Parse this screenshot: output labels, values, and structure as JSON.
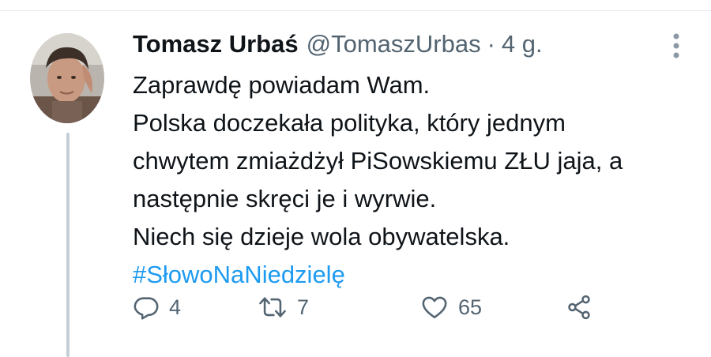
{
  "tweet": {
    "author": {
      "name": "Tomasz Urbaś",
      "handle": "@TomaszUrbas"
    },
    "separator": "·",
    "timestamp": "4 g.",
    "text_lines": [
      "Zaprawdę powiadam Wam.",
      "Polska doczekała polityka, który jednym",
      "chwytem zmiażdżył PiSowskiemu ZŁU jaja, a",
      "następnie skręci je i wyrwie.",
      "Niech się dzieje wola obywatelska."
    ],
    "hashtag": "#SłowoNaNiedzielę",
    "actions": {
      "reply": {
        "icon": "reply-icon",
        "count": "4"
      },
      "retweet": {
        "icon": "retweet-icon",
        "count": "7"
      },
      "like": {
        "icon": "heart-icon",
        "count": "65"
      },
      "share": {
        "icon": "share-icon"
      }
    },
    "more": {
      "icon": "more-vertical-icon"
    }
  },
  "colors": {
    "text_primary": "#0f1419",
    "text_secondary": "#536471",
    "hashtag": "#1d9bf0",
    "thread_line": "#c4cfd6",
    "divider": "#e6ecf0"
  }
}
